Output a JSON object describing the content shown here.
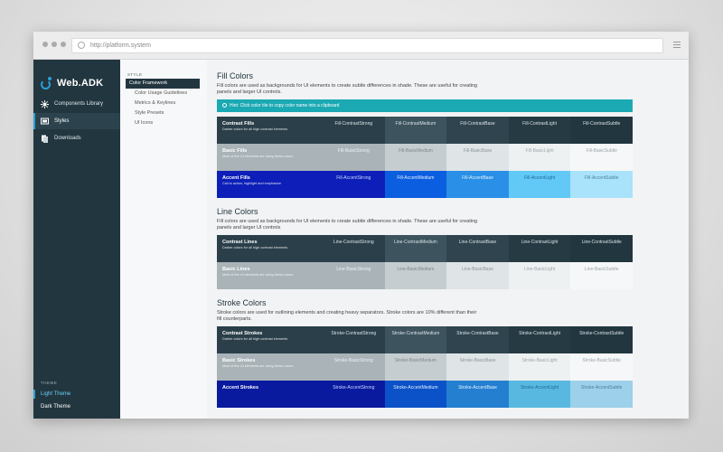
{
  "browser": {
    "url": "http://platform.system"
  },
  "app": {
    "name": "Web.ADK"
  },
  "nav": {
    "items": [
      {
        "label": "Components Library",
        "active": false
      },
      {
        "label": "Styles",
        "active": true
      },
      {
        "label": "Downloads",
        "active": false
      }
    ],
    "theme_heading": "THEME",
    "themes": [
      {
        "label": "Light Theme",
        "active": true
      },
      {
        "label": "Dark Theme",
        "active": false
      }
    ]
  },
  "subnav": {
    "heading": "STYLE",
    "items": [
      {
        "label": "Color Framework",
        "active": true
      },
      {
        "label": "Color Usage Guidelines",
        "active": false
      },
      {
        "label": "Metrics & Keylines",
        "active": false
      },
      {
        "label": "Style Presets",
        "active": false
      },
      {
        "label": "UI Icons",
        "active": false
      }
    ]
  },
  "sections": [
    {
      "title": "Fill Colors",
      "description": "Fill colors are used as backgrounds for UI elements to create subtle differences in shade. These are useful for creating panels and larger UI controls.",
      "hint": "Hint: Click color tile to copy color name into a clipboard",
      "rows": [
        {
          "name": "Contrast Fills",
          "desc": "Darker colors for all high contrast elements",
          "label_bg": "#2a3f49",
          "label_fg": "#ffffff",
          "cells": [
            {
              "text": "Fill-ContrastStrong",
              "bg": "#2a3f49",
              "fg": "#d8e2e7"
            },
            {
              "text": "Fill-ContrastMedium",
              "bg": "#3d535e",
              "fg": "#d8e2e7"
            },
            {
              "text": "Fill-ContrastBase",
              "bg": "#2f444e",
              "fg": "#d8e2e7"
            },
            {
              "text": "Fill-ContrastLight",
              "bg": "#263a43",
              "fg": "#d8e2e7"
            },
            {
              "text": "Fill-ContrastSubtle",
              "bg": "#22363f",
              "fg": "#d8e2e7"
            }
          ]
        },
        {
          "name": "Basic Fills",
          "desc": "Most of the UI elements are using these colors",
          "label_bg": "#a9b3b8",
          "label_fg": "#ffffff",
          "cells": [
            {
              "text": "Fill-BasicStrong",
              "bg": "#a9b3b8",
              "fg": "#eef1f2"
            },
            {
              "text": "Fill-BasicMedium",
              "bg": "#c6cdd0",
              "fg": "#7b878d"
            },
            {
              "text": "Fill-BasicBase",
              "bg": "#dfe4e6",
              "fg": "#8a969b"
            },
            {
              "text": "Fill-BasicLight",
              "bg": "#eef1f2",
              "fg": "#9ba6ab"
            },
            {
              "text": "Fill-BasicSubtle",
              "bg": "#f6f7f8",
              "fg": "#9ba6ab"
            }
          ]
        },
        {
          "name": "Accent Fills",
          "desc": "Call to action, highlight and emphasize",
          "label_bg": "#0d1fb8",
          "label_fg": "#ffffff",
          "cells": [
            {
              "text": "Fill-AccentStrong",
              "bg": "#0d1fb8",
              "fg": "#c9d6ff"
            },
            {
              "text": "Fill-AccentMedium",
              "bg": "#0c5ee0",
              "fg": "#e6f0ff"
            },
            {
              "text": "Fill-AccentBase",
              "bg": "#2a8fe6",
              "fg": "#e6f5ff"
            },
            {
              "text": "Fill-AccentLight",
              "bg": "#62c9f6",
              "fg": "#1f6a99"
            },
            {
              "text": "Fill-AccentSubtle",
              "bg": "#a9e2fb",
              "fg": "#4c7f99"
            }
          ]
        }
      ]
    },
    {
      "title": "Line Colors",
      "description": "Fill colors are used as backgrounds for UI elements to create subtle differences in shade. These are useful for creating panels and larger UI controls",
      "hint": "",
      "rows": [
        {
          "name": "Contrast Lines",
          "desc": "Darker colors for all high contrast elements",
          "label_bg": "#2a3f49",
          "label_fg": "#ffffff",
          "cells": [
            {
              "text": "Line-ContrastStrong",
              "bg": "#2a3f49",
              "fg": "#d8e2e7"
            },
            {
              "text": "Line-ContrastMedium",
              "bg": "#3d535e",
              "fg": "#d8e2e7"
            },
            {
              "text": "Line-ContrastBase",
              "bg": "#2f444e",
              "fg": "#d8e2e7"
            },
            {
              "text": "Line-ContrastLight",
              "bg": "#263a43",
              "fg": "#d8e2e7"
            },
            {
              "text": "Line-ContrastSubtle",
              "bg": "#22363f",
              "fg": "#d8e2e7"
            }
          ]
        },
        {
          "name": "Basic Lines",
          "desc": "Most of the UI elements are using these colors",
          "label_bg": "#a9b3b8",
          "label_fg": "#ffffff",
          "cells": [
            {
              "text": "Line-BasicStrong",
              "bg": "#a9b3b8",
              "fg": "#eef1f2"
            },
            {
              "text": "Line-BasicMedium",
              "bg": "#c6cdd0",
              "fg": "#7b878d"
            },
            {
              "text": "Line-BasicBase",
              "bg": "#dfe4e6",
              "fg": "#8a969b"
            },
            {
              "text": "Line-BasicLight",
              "bg": "#eef1f2",
              "fg": "#9ba6ab"
            },
            {
              "text": "Line-BasicSubtle",
              "bg": "#f6f7f8",
              "fg": "#9ba6ab"
            }
          ]
        }
      ]
    },
    {
      "title": "Stroke Colors",
      "description": "Stroke colors are used for outlining elements and creating heavy separators. Stroke colors are 10% different than their fill counterparts.",
      "hint": "",
      "rows": [
        {
          "name": "Contrast Strokes",
          "desc": "Darker colors for all high contrast elements",
          "label_bg": "#2a3f49",
          "label_fg": "#ffffff",
          "cells": [
            {
              "text": "Stroke-ContrastStrong",
              "bg": "#2a3f49",
              "fg": "#d8e2e7"
            },
            {
              "text": "Stroke-ContrastMedium",
              "bg": "#3d535e",
              "fg": "#d8e2e7"
            },
            {
              "text": "Stroke-ContrastBase",
              "bg": "#2f444e",
              "fg": "#d8e2e7"
            },
            {
              "text": "Stroke-ContrastLight",
              "bg": "#263a43",
              "fg": "#d8e2e7"
            },
            {
              "text": "Stroke-ContrastSubtle",
              "bg": "#22363f",
              "fg": "#d8e2e7"
            }
          ]
        },
        {
          "name": "Basic Strokes",
          "desc": "Most of the UI elements are using these colors",
          "label_bg": "#a9b3b8",
          "label_fg": "#ffffff",
          "cells": [
            {
              "text": "Stroke-BasicStrong",
              "bg": "#a9b3b8",
              "fg": "#eef1f2"
            },
            {
              "text": "Stroke-BasicMedium",
              "bg": "#c6cdd0",
              "fg": "#7b878d"
            },
            {
              "text": "Stroke-BasicBase",
              "bg": "#dfe4e6",
              "fg": "#8a969b"
            },
            {
              "text": "Stroke-BasicLight",
              "bg": "#eef1f2",
              "fg": "#9ba6ab"
            },
            {
              "text": "Stroke-BasicSubtle",
              "bg": "#f6f7f8",
              "fg": "#9ba6ab"
            }
          ]
        },
        {
          "name": "Accent Strokes",
          "desc": "",
          "label_bg": "#0a1a9e",
          "label_fg": "#ffffff",
          "cells": [
            {
              "text": "Stroke-AccentStrong",
              "bg": "#0a1a9e",
              "fg": "#c9d6ff"
            },
            {
              "text": "Stroke-AccentMedium",
              "bg": "#0b52c9",
              "fg": "#e6f0ff"
            },
            {
              "text": "Stroke-AccentBase",
              "bg": "#247fd0",
              "fg": "#e6f5ff"
            },
            {
              "text": "Stroke-AccentLight",
              "bg": "#58b8e0",
              "fg": "#1f6a99"
            },
            {
              "text": "Stroke-AccentSubtle",
              "bg": "#9dd0ea",
              "fg": "#4c7f99"
            }
          ]
        }
      ]
    }
  ]
}
